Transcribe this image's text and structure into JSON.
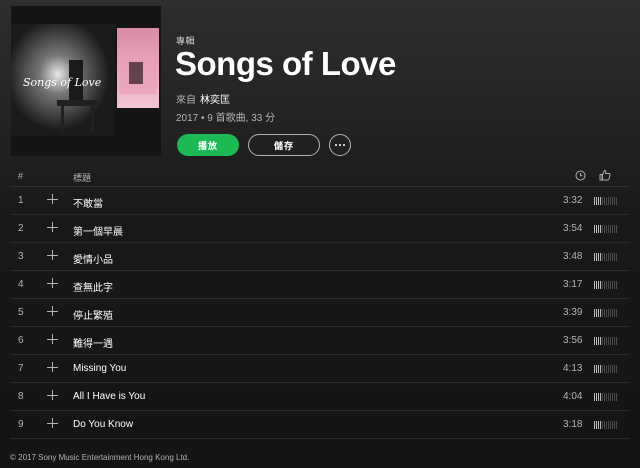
{
  "album": {
    "type_label": "專輯",
    "title": "Songs of Love",
    "by_label": "來自",
    "artist": "林奕匡",
    "meta": "2017 • 9 首歌曲, 33 分",
    "cover_text": "Songs of Love"
  },
  "actions": {
    "play_label": "播放",
    "save_label": "儲存"
  },
  "table": {
    "num_header": "#",
    "title_header": "標題",
    "tracks": [
      {
        "num": "1",
        "title": "不敢當",
        "duration": "3:32",
        "popularity": 0.35
      },
      {
        "num": "2",
        "title": "第一個早晨",
        "duration": "3:54",
        "popularity": 0.35
      },
      {
        "num": "3",
        "title": "愛情小品",
        "duration": "3:48",
        "popularity": 0.3
      },
      {
        "num": "4",
        "title": "查無此字",
        "duration": "3:17",
        "popularity": 0.3
      },
      {
        "num": "5",
        "title": "停止繁殖",
        "duration": "3:39",
        "popularity": 0.3
      },
      {
        "num": "6",
        "title": "難得一遇",
        "duration": "3:56",
        "popularity": 0.3
      },
      {
        "num": "7",
        "title": "Missing You",
        "duration": "4:13",
        "popularity": 0.3
      },
      {
        "num": "8",
        "title": "All I Have is You",
        "duration": "4:04",
        "popularity": 0.3
      },
      {
        "num": "9",
        "title": "Do You Know",
        "duration": "3:18",
        "popularity": 0.3
      }
    ]
  },
  "footer": {
    "copyright": "© 2017 Sony Music Entertainment Hong Kong Ltd."
  },
  "colors": {
    "accent": "#1db954",
    "text_secondary": "#b3b3b3"
  }
}
